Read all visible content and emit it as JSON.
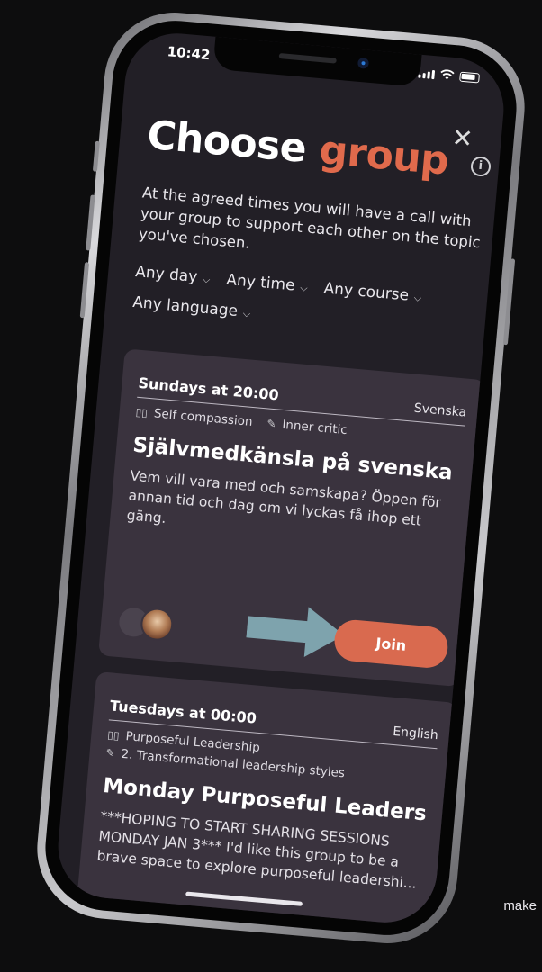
{
  "status_bar": {
    "time": "10:42"
  },
  "header": {
    "title_main": "Choose",
    "title_accent": "group",
    "subtitle": "At the agreed times you will have a call with your group to support each other on the topic you've chosen."
  },
  "filters": [
    {
      "label": "Any day"
    },
    {
      "label": "Any time"
    },
    {
      "label": "Any course"
    },
    {
      "label": "Any language"
    }
  ],
  "groups": [
    {
      "schedule": "Sundays at 20:00",
      "language": "Svenska",
      "course": "Self compassion",
      "topic": "Inner critic",
      "name": "Självmedkänsla på svenska",
      "description": "Vem vill vara med och samskapa? Öppen för annan tid och dag om vi lyckas få ihop ett gäng.",
      "join_label": "Join"
    },
    {
      "schedule": "Tuesdays at 00:00",
      "language": "English",
      "course": "Purposeful Leadership",
      "topic": "2. Transformational leadership styles",
      "name": "Monday Purposeful Leaders",
      "description": "***HOPING TO START SHARING SESSIONS MONDAY JAN 3*** I'd like this group to be a brave space to explore purposeful leadershi..."
    }
  ],
  "edge_text": "make",
  "colors": {
    "accent": "#e06a4c",
    "join_button": "#d96a4f",
    "background": "#221f26",
    "card": "#3a333e",
    "arrow": "#7ea3ad"
  },
  "icons": {
    "close": "close-icon",
    "info": "info-icon",
    "chevron": "chevron-down-icon",
    "course": "book-icon",
    "topic": "edit-icon"
  }
}
